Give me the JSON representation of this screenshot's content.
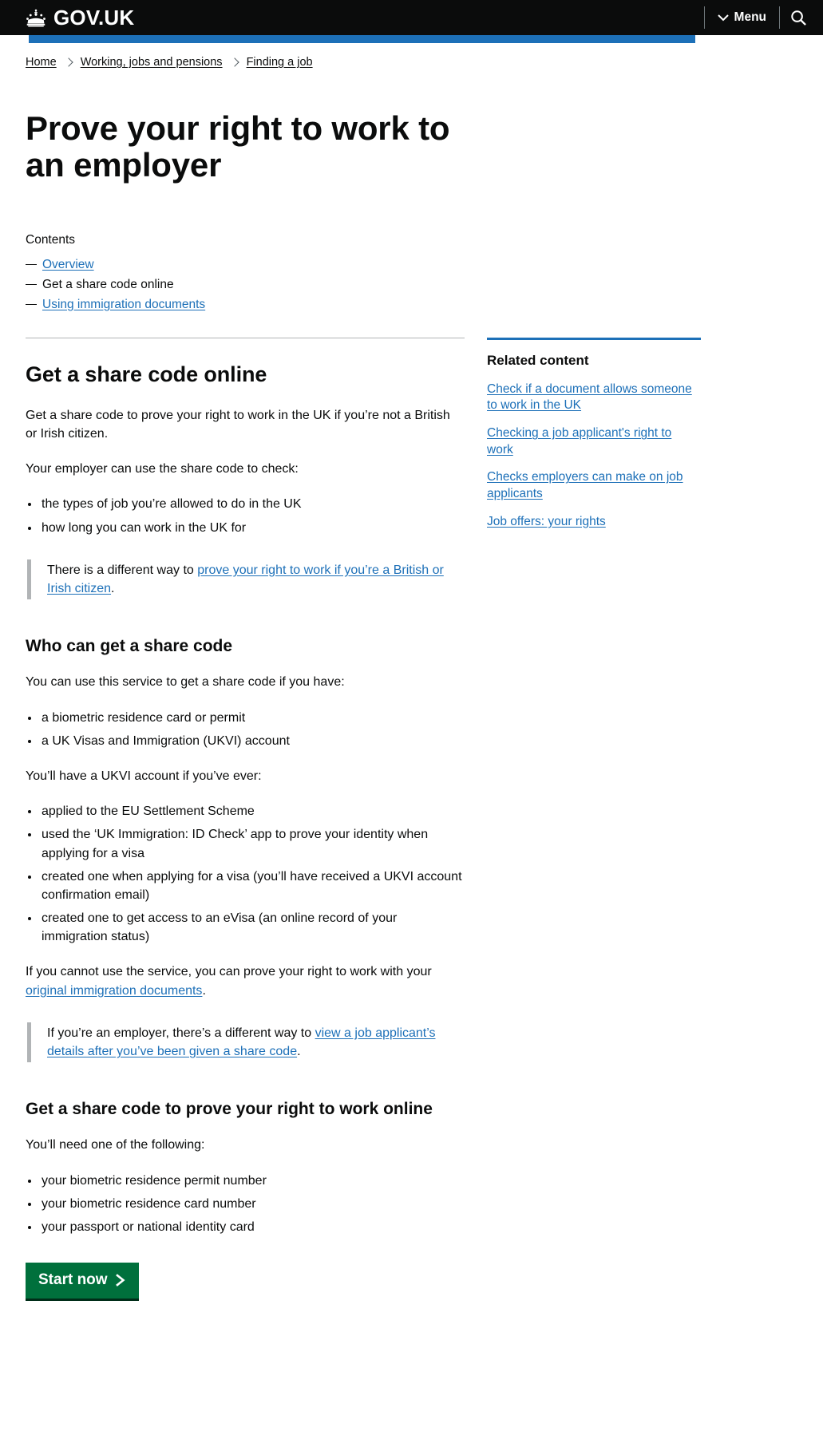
{
  "header": {
    "brand_name": "GOV.UK",
    "menu_label": "Menu",
    "search_icon": "search-icon",
    "chevron_icon": "chevron-down-icon",
    "crown_icon": "crown-icon",
    "brand_blue": "#1d70b8",
    "background": "#0b0c0c"
  },
  "breadcrumb": {
    "items": [
      {
        "label": "Home"
      },
      {
        "label": "Working, jobs and pensions"
      },
      {
        "label": "Finding a job"
      }
    ]
  },
  "page_title": "Prove your right to work to an employer",
  "contents": {
    "label": "Contents",
    "items": [
      {
        "label": "Overview",
        "current": false
      },
      {
        "label": "Get a share code online",
        "current": true
      },
      {
        "label": "Using immigration documents",
        "current": false
      }
    ]
  },
  "main": {
    "heading": "Get a share code online",
    "intro": "Get a share code to prove your right to work in the UK if you’re not a British or Irish citizen.",
    "employer_check_lead": "Your employer can use the share code to check:",
    "employer_check_items": [
      "the types of job you’re allowed to do in the UK",
      "how long you can work in the UK for"
    ],
    "inset_one": {
      "before": "There is a different way to ",
      "link": "prove your right to work if you’re a British or Irish citizen",
      "after": "."
    },
    "who_heading": "Who can get a share code",
    "who_lead": "You can use this service to get a share code if you have:",
    "who_items": [
      "a biometric residence card or permit",
      "a UK Visas and Immigration (UKVI) account"
    ],
    "ukvi_lead": "You’ll have a UKVI account if you’ve ever:",
    "ukvi_items": [
      "applied to the EU Settlement Scheme",
      "used the ‘UK Immigration: ID Check’ app to prove your identity when applying for a visa",
      "created one when applying for a visa (you’ll have received a UKVI account confirmation email)",
      "created one to get access to an eVisa (an online record of your immigration status)"
    ],
    "cannot_use": {
      "before": "If you cannot use the service, you can prove your right to work with your ",
      "link": "original immigration documents",
      "after": "."
    },
    "inset_two": {
      "before": "If you’re an employer, there’s a different way to ",
      "link": "view a job applicant’s details after you’ve been given a share code",
      "after": "."
    },
    "get_code_heading": "Get a share code to prove your right to work online",
    "need_lead": "You’ll need one of the following:",
    "need_items": [
      "your biometric residence permit number",
      "your biometric residence card number",
      "your passport or national identity card"
    ],
    "start_button": {
      "label": "Start now",
      "icon": "arrow-right-icon",
      "color": "#00703c"
    }
  },
  "sidebar": {
    "related_heading": "Related content",
    "links": [
      "Check if a document allows someone to work in the UK",
      "Checking a job applicant's right to work",
      "Checks employers can make on job applicants",
      "Job offers: your rights"
    ]
  }
}
